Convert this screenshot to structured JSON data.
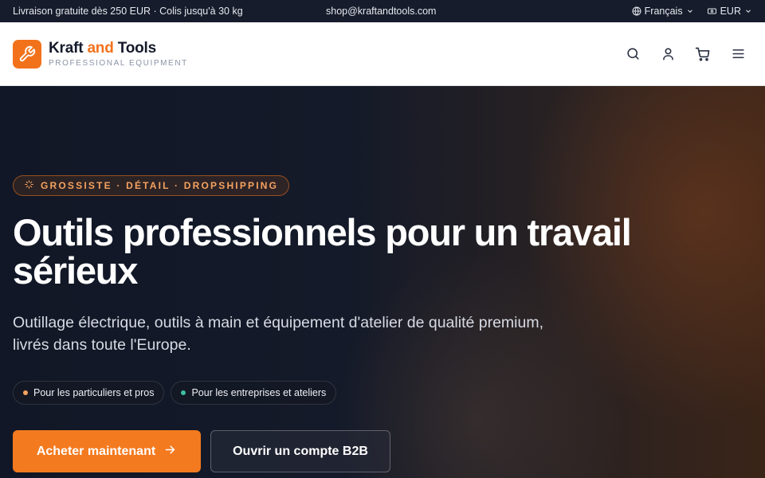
{
  "topbar": {
    "shipping_text": "Livraison gratuite dès 250 EUR · Colis jusqu'à 30 kg",
    "email": "shop@kraftandtools.com",
    "language": "Français",
    "currency": "EUR"
  },
  "brand": {
    "name_part1": "Kraft",
    "name_part2": "and",
    "name_part3": "Tools",
    "tagline": "PROFESSIONAL EQUIPMENT",
    "accent_color": "#f2721c"
  },
  "header": {
    "icons": [
      "search-icon",
      "user-icon",
      "cart-icon",
      "menu-icon"
    ]
  },
  "hero": {
    "badge": "GROSSISTE · DÉTAIL · DROPSHIPPING",
    "title": "Outils professionnels pour un travail sérieux",
    "subtitle": "Outillage électrique, outils à main et équipement d'atelier de qualité premium, livrés dans toute l'Europe.",
    "pills": [
      {
        "label": "Pour les particuliers et pros",
        "dot_color": "#f5a25f"
      },
      {
        "label": "Pour les entreprises et ateliers",
        "dot_color": "#3fbf9f"
      }
    ],
    "primary_cta": "Acheter maintenant",
    "secondary_cta": "Ouvrir un compte B2B"
  }
}
